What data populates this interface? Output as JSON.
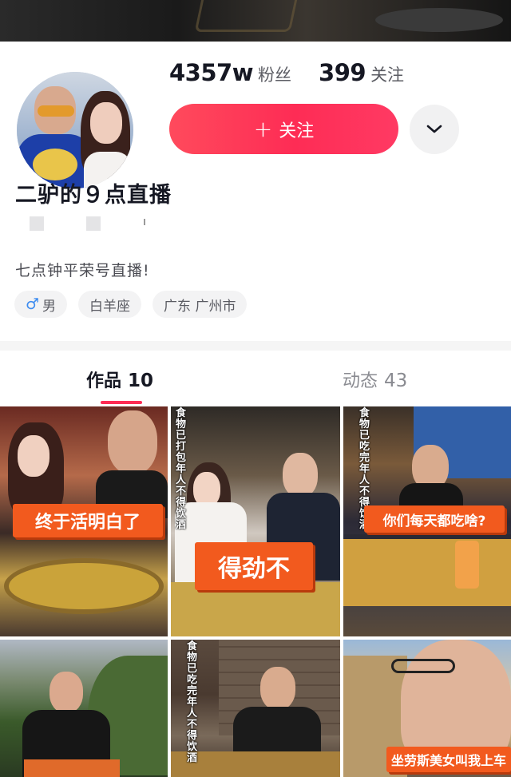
{
  "profile": {
    "followers_count": "4357w",
    "followers_label": "粉丝",
    "following_count": "399",
    "following_label": "关注",
    "follow_button_label": "关注",
    "follow_button_icon": "plus-icon",
    "more_button_icon": "chevron-down-icon",
    "nickname": "二驴的９点直播",
    "signature": "七点钟平荣号直播!",
    "tags": [
      {
        "icon": "male-icon",
        "label": "男"
      },
      {
        "label": "白羊座"
      },
      {
        "label": "广东 广州市"
      }
    ]
  },
  "tabs": [
    {
      "label": "作品",
      "count": "10",
      "active": true
    },
    {
      "label": "动态",
      "count": "43",
      "active": false
    }
  ],
  "videos": [
    {
      "caption": "终于活明白了"
    },
    {
      "caption": "得劲不",
      "side_text": "食物已打包年人不得饮酒"
    },
    {
      "caption": "你们每天都吃啥?",
      "side_text": "食物已吃完年人不得饮酒"
    },
    {
      "caption": ""
    },
    {
      "caption": "",
      "side_text": "食物已吃完年人不得饮酒"
    },
    {
      "caption": "坐劳斯美女叫我上车"
    }
  ],
  "colors": {
    "accent": "#fe2c55",
    "caption_bg": "#f25a1e",
    "male_blue": "#3d8cf0"
  }
}
